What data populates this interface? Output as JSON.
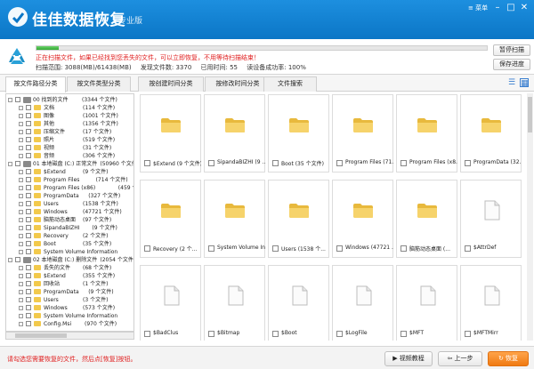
{
  "app": {
    "title": "佳佳数据恢复",
    "edition": "专业版",
    "menu": "菜单"
  },
  "scan": {
    "progress": 0.05,
    "message": "正在扫描文件，如果已经找到您丢失的文件，可以立即恢复，不用等待扫描结束！",
    "range": "扫描范围: 3088(MB)/61438(MB)",
    "found": "发现文件数: 3370",
    "elapsed": "已用时间: 55",
    "speed": "读设备成功率: 100%",
    "pause_label": "暂停扫描",
    "save_label": "保存进度"
  },
  "tabs": [
    "按文件路径分类",
    "按文件类型分类",
    "按创建时间分类",
    "按修改时间分类",
    "文件搜索"
  ],
  "tree": [
    {
      "level": 0,
      "kind": "drive",
      "label": "00 找到的文件",
      "count": "(3344 个文件)"
    },
    {
      "level": 1,
      "kind": "folder",
      "label": "文档",
      "count": "(114 个文件)"
    },
    {
      "level": 1,
      "kind": "folder",
      "label": "图像",
      "count": "(1001 个文件)"
    },
    {
      "level": 1,
      "kind": "folder",
      "label": "其他",
      "count": "(1356 个文件)"
    },
    {
      "level": 1,
      "kind": "folder",
      "label": "压缩文件",
      "count": "(17 个文件)"
    },
    {
      "level": 1,
      "kind": "folder",
      "label": "照片",
      "count": "(519 个文件)"
    },
    {
      "level": 1,
      "kind": "folder",
      "label": "视频",
      "count": "(31 个文件)"
    },
    {
      "level": 1,
      "kind": "folder",
      "label": "音频",
      "count": "(306 个文件)"
    },
    {
      "level": 0,
      "kind": "drive",
      "label": "01 本地磁盘 (C:) 正常文件",
      "count": "(50960 个文件)"
    },
    {
      "level": 1,
      "kind": "folder",
      "label": "$Extend",
      "count": "(9 个文件)"
    },
    {
      "level": 1,
      "kind": "folder",
      "label": "Program Files",
      "count": "(714 个文件)"
    },
    {
      "level": 1,
      "kind": "folder",
      "label": "Program Files (x86)",
      "count": "(459 个文件)"
    },
    {
      "level": 1,
      "kind": "folder",
      "label": "ProgramData",
      "count": "(327 个文件)"
    },
    {
      "level": 1,
      "kind": "folder",
      "label": "Users",
      "count": "(1538 个文件)"
    },
    {
      "level": 1,
      "kind": "folder",
      "label": "Windows",
      "count": "(47721 个文件)"
    },
    {
      "level": 1,
      "kind": "folder",
      "label": "脑筋动态桌面",
      "count": "(97 个文件)"
    },
    {
      "level": 1,
      "kind": "folder",
      "label": "SipandaBIZHI",
      "count": "(9 个文件)"
    },
    {
      "level": 1,
      "kind": "folder",
      "label": "Recovery",
      "count": "(2 个文件)"
    },
    {
      "level": 1,
      "kind": "folder",
      "label": "Boot",
      "count": "(35 个文件)"
    },
    {
      "level": 1,
      "kind": "folder",
      "label": "System Volume Information",
      "count": "(10 个"
    },
    {
      "level": 0,
      "kind": "drive",
      "label": "02 本地磁盘 (C:) 删除文件",
      "count": "(2054 个文件)"
    },
    {
      "level": 1,
      "kind": "folder",
      "label": "丢失的文件",
      "count": "(68 个文件)"
    },
    {
      "level": 1,
      "kind": "folder",
      "label": "$Extend",
      "count": "(355 个文件)"
    },
    {
      "level": 1,
      "kind": "folder",
      "label": "回收站",
      "count": "(1 个文件)"
    },
    {
      "level": 1,
      "kind": "folder",
      "label": "ProgramData",
      "count": "(9 个文件)"
    },
    {
      "level": 1,
      "kind": "folder",
      "label": "Users",
      "count": "(3 个文件)"
    },
    {
      "level": 1,
      "kind": "folder",
      "label": "Windows",
      "count": "(573 个文件)"
    },
    {
      "level": 1,
      "kind": "folder",
      "label": "System Volume Information",
      "count": "(75 个"
    },
    {
      "level": 1,
      "kind": "folder",
      "label": "Config.Msi",
      "count": "(970 个文件)"
    }
  ],
  "grid": [
    {
      "kind": "folder",
      "name": "$Extend (9 个文件)"
    },
    {
      "kind": "folder",
      "name": "SipandaBIZHI (9 ..."
    },
    {
      "kind": "folder",
      "name": "Boot (35 个文件)"
    },
    {
      "kind": "folder",
      "name": "Program Files (71..."
    },
    {
      "kind": "folder",
      "name": "Program Files (x8..."
    },
    {
      "kind": "folder",
      "name": "ProgramData (32..."
    },
    {
      "kind": "folder",
      "name": "Recovery (2 个..."
    },
    {
      "kind": "folder",
      "name": "System Volume In..."
    },
    {
      "kind": "folder",
      "name": "Users (1538 个..."
    },
    {
      "kind": "folder",
      "name": "Windows (47721 ..."
    },
    {
      "kind": "folder",
      "name": "脑筋动态桌面 (..."
    },
    {
      "kind": "file",
      "name": "$AttrDef"
    },
    {
      "kind": "file",
      "name": "$BadClus"
    },
    {
      "kind": "file",
      "name": "$Bitmap"
    },
    {
      "kind": "file",
      "name": "$Boot"
    },
    {
      "kind": "file",
      "name": "$LogFile"
    },
    {
      "kind": "file",
      "name": "$MFT"
    },
    {
      "kind": "file",
      "name": "$MFTMirr"
    }
  ],
  "footer": {
    "hint": "请勾选您需要恢复的文件，然后点[恢复]按钮。",
    "tutorial": "视频教程",
    "prev": "上一步",
    "recover": "恢复"
  }
}
